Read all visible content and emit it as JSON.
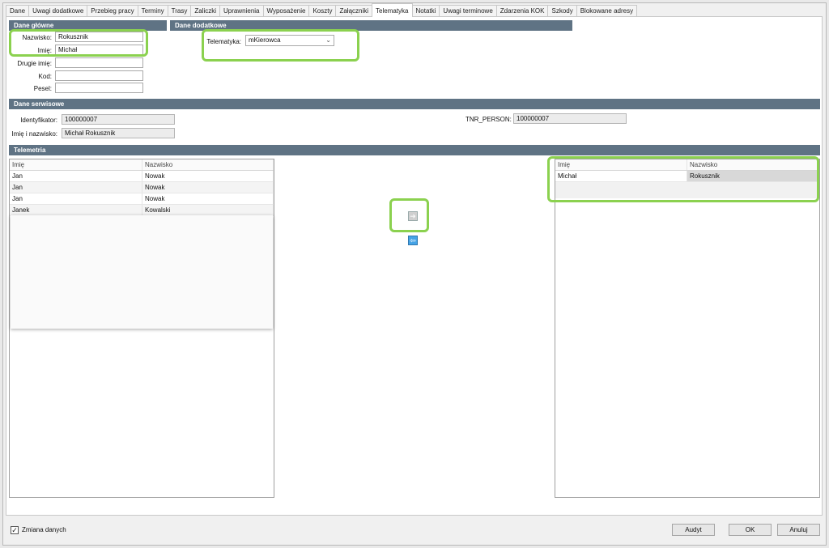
{
  "tabs": [
    {
      "label": "Dane"
    },
    {
      "label": "Uwagi dodatkowe"
    },
    {
      "label": "Przebieg pracy"
    },
    {
      "label": "Terminy"
    },
    {
      "label": "Trasy"
    },
    {
      "label": "Zaliczki"
    },
    {
      "label": "Uprawnienia"
    },
    {
      "label": "Wyposażenie"
    },
    {
      "label": "Koszty"
    },
    {
      "label": "Załączniki"
    },
    {
      "label": "Telematyka"
    },
    {
      "label": "Notatki"
    },
    {
      "label": "Uwagi terminowe"
    },
    {
      "label": "Zdarzenia KOK"
    },
    {
      "label": "Szkody"
    },
    {
      "label": "Blokowane adresy"
    }
  ],
  "active_tab": "Telematyka",
  "dane_glowne": {
    "title": "Dane główne",
    "nazwisko_label": "Nazwisko:",
    "nazwisko_value": "Rokusznik",
    "imie_label": "Imię:",
    "imie_value": "Michał",
    "drugie_imie_label": "Drugie imię:",
    "drugie_imie_value": "",
    "kod_label": "Kod:",
    "kod_value": "",
    "pesel_label": "Pesel:",
    "pesel_value": ""
  },
  "dane_dodatkowe": {
    "title": "Dane dodatkowe",
    "telematyka_label": "Telematyka:",
    "telematyka_value": "mKierowca"
  },
  "dane_serwisowe": {
    "title": "Dane serwisowe",
    "identyfikator_label": "Identyfikator:",
    "identyfikator_value": "100000007",
    "imie_nazwisko_label": "Imię i nazwisko:",
    "imie_nazwisko_value": "Michał Rokusznik",
    "tnr_label": "TNR_PERSON:",
    "tnr_value": "100000007"
  },
  "telemetria": {
    "title": "Telemetria",
    "left_grid": {
      "headers": [
        "Imię",
        "Nazwisko"
      ],
      "rows": [
        [
          "Jan",
          "Nowak"
        ],
        [
          "Jan",
          "Nowak"
        ],
        [
          "Jan",
          "Nowak"
        ],
        [
          "Janek",
          "Kowalski"
        ]
      ]
    },
    "right_grid": {
      "headers": [
        "Imię",
        "Nazwisko"
      ],
      "rows": [
        [
          "Michał",
          "Rokusznik"
        ]
      ]
    }
  },
  "footer": {
    "checkbox_label": "Zmiana danych",
    "checkbox_checked": true,
    "audyt": "Audyt",
    "ok": "OK",
    "anuluj": "Anuluj"
  },
  "colors": {
    "section_bar": "#5f7384",
    "highlight": "#8bd14f"
  }
}
